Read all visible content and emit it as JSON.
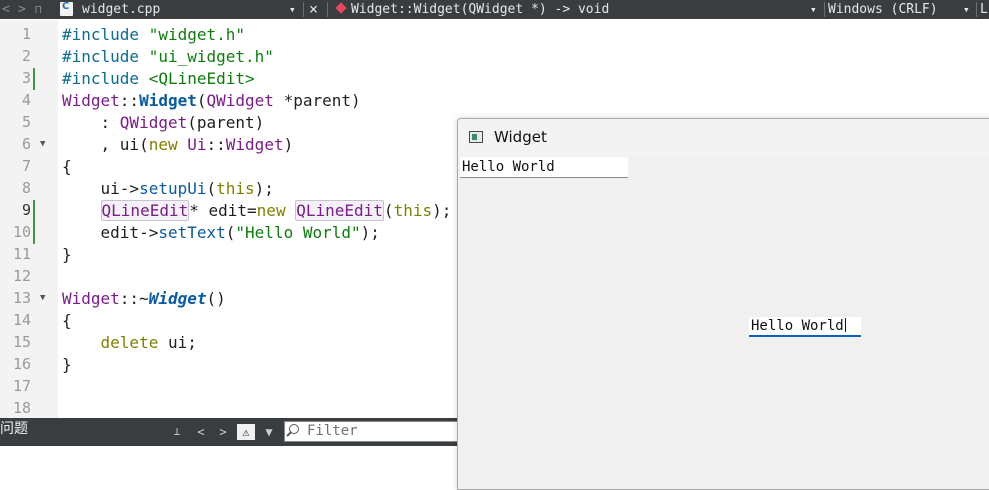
{
  "toolbar": {
    "back_icon": "chevron-left-icon",
    "forward_icon": "chevron-right-icon",
    "file_name": "widget.cpp",
    "dropdown_glyph": "▾",
    "close_glyph": "×",
    "symbol": "Widget::Widget(QWidget *) -> void",
    "line_endings": "Windows (CRLF)",
    "right_cut": "L"
  },
  "editor": {
    "line_numbers": [
      "1",
      "2",
      "3",
      "4",
      "5",
      "6",
      "7",
      "8",
      "9",
      "10",
      "11",
      "12",
      "13",
      "14",
      "15",
      "16",
      "17",
      "18"
    ],
    "current_line": "9",
    "code": {
      "l1_pp": "#include",
      "l1_str": "\"widget.h\"",
      "l2_pp": "#include",
      "l2_str": "\"ui_widget.h\"",
      "l3_pp": "#include",
      "l3_str": "<QLineEdit>",
      "l4_type": "Widget",
      "l4_sep": "::",
      "l4_fn": "Widget",
      "l4_rest1": "(",
      "l4_type2": "QWidget",
      "l4_rest2": " *parent)",
      "l5_pre": "    : ",
      "l5_type": "QWidget",
      "l5_rest": "(parent)",
      "l6_pre": "    , ui(",
      "l6_kw": "new",
      "l6_sp": " ",
      "l6_type": "Ui",
      "l6_sep": "::",
      "l6_type2": "Widget",
      "l6_rest": ")",
      "l7": "{",
      "l8_pre": "    ui->",
      "l8_fn": "setupUi",
      "l8_rest1": "(",
      "l8_kw": "this",
      "l8_rest2": ");",
      "l9_pre": "    ",
      "l9_type": "QLineEdit",
      "l9_mid": "* edit=",
      "l9_kw": "new",
      "l9_sp": " ",
      "l9_type2": "QLineEdit",
      "l9_rest1": "(",
      "l9_kw2": "this",
      "l9_rest2": ");",
      "l10_pre": "    edit->",
      "l10_fn": "setText",
      "l10_rest1": "(",
      "l10_str": "\"Hello World\"",
      "l10_rest2": ");",
      "l11": "}",
      "l13_type": "Widget",
      "l13_sep": "::~",
      "l13_fn": "Widget",
      "l13_rest": "()",
      "l14": "{",
      "l15_pre": "    ",
      "l15_kw": "delete",
      "l15_rest": " ui;",
      "l16": "}"
    }
  },
  "issues_panel": {
    "title": "问题",
    "warning_glyph": "⚠",
    "filter_placeholder": "Filter",
    "toggle_icon": "tree-toggle-icon",
    "filter_icon": "funnel-icon"
  },
  "app_window": {
    "title": "Widget",
    "line_edit_top": "Hello World",
    "line_edit_center": "Hello World"
  },
  "colors": {
    "toolbar_bg": "#3a3d40",
    "change_bar": "#3f9a3f",
    "focus_underline": "#0a63b8"
  }
}
